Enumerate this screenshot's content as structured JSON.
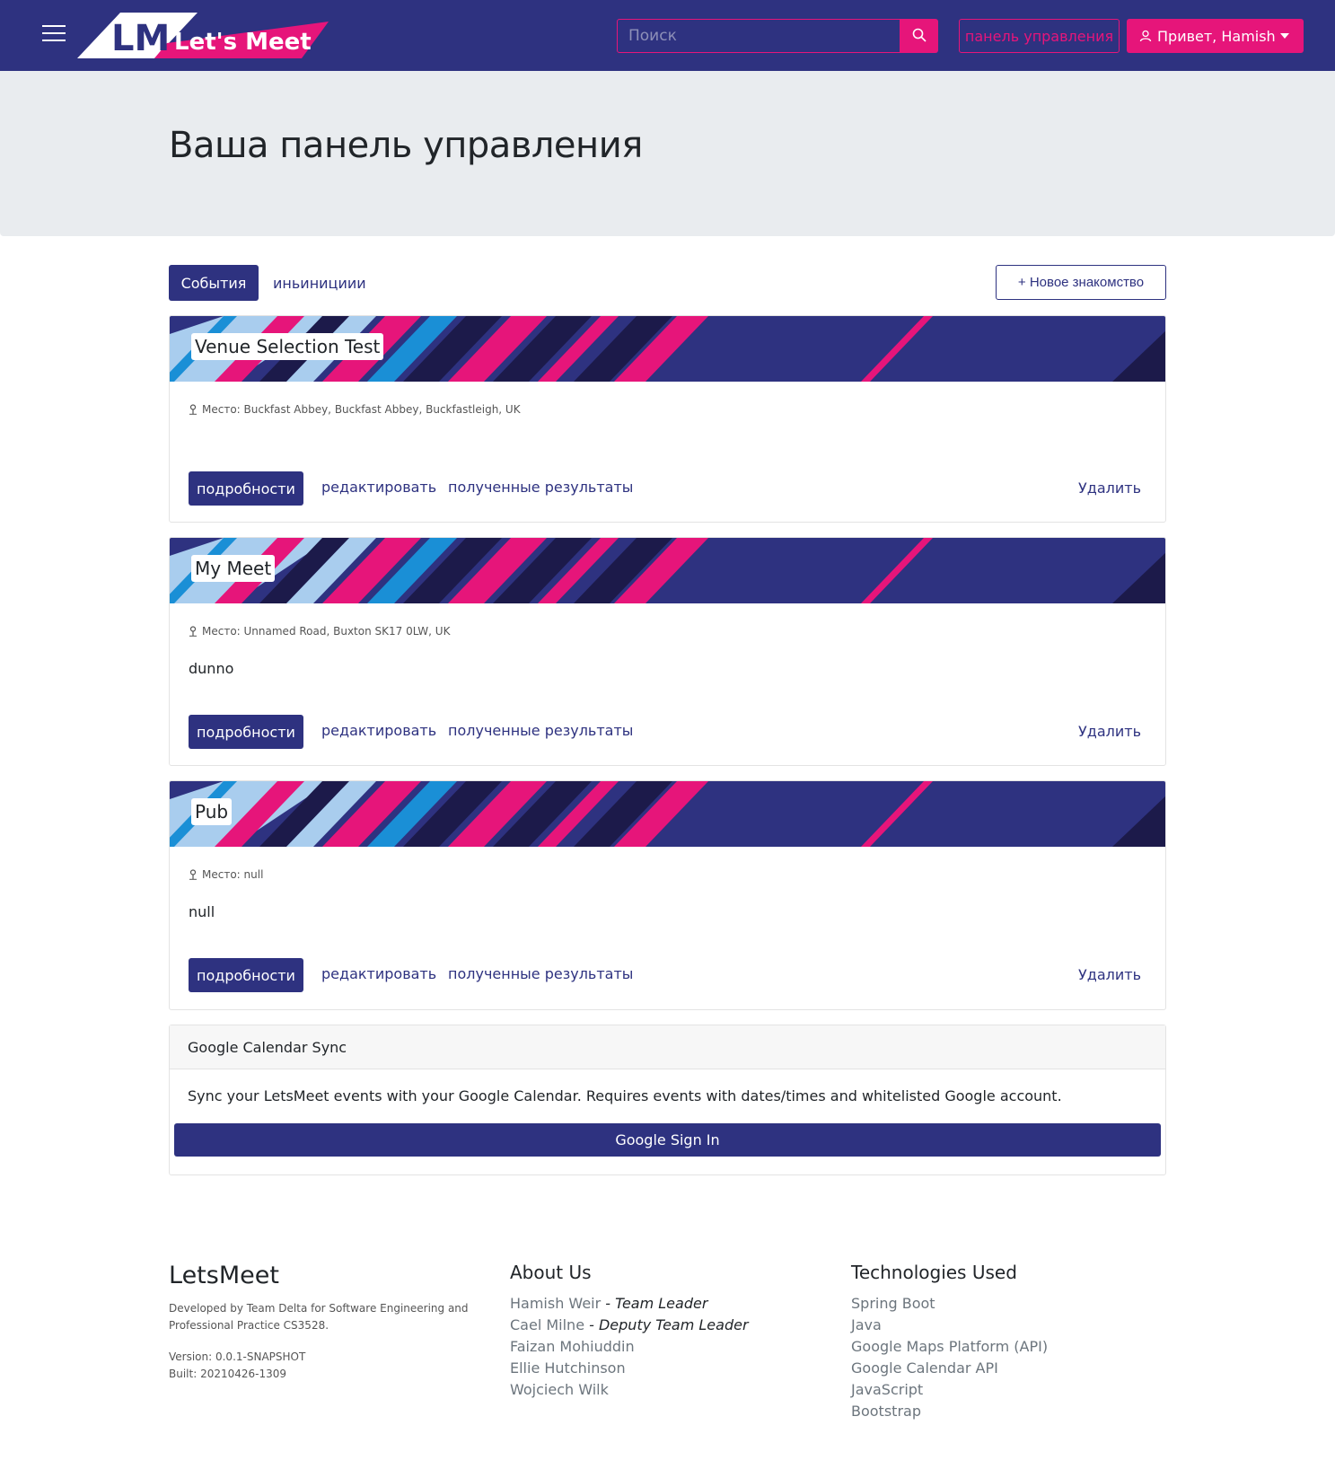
{
  "navbar": {
    "logo_text": "Let's Meet",
    "logo_mark": "LM",
    "search_placeholder": "Поиск",
    "dashboard_label": "панель управления",
    "user_label": "Привет, Hamish"
  },
  "page": {
    "title": "Ваша панель управления"
  },
  "tabs": {
    "events_label": "События",
    "initiatives_label": "иньинициии",
    "new_meet_label": "+ Новое знакомство"
  },
  "actions": {
    "details": "подробности",
    "edit": "редактировать",
    "results": "полученные результаты",
    "delete": "Удалить"
  },
  "events": [
    {
      "title": "Venue Selection Test",
      "location": "Место: Buckfast Abbey, Buckfast Abbey, Buckfastleigh, UK",
      "description": ""
    },
    {
      "title": "My Meet",
      "location": "Место: Unnamed Road, Buxton SK17 0LW, UK",
      "description": "dunno"
    },
    {
      "title": "Pub",
      "location": "Место: null",
      "description": "null"
    }
  ],
  "gcal": {
    "header": "Google Calendar Sync",
    "text": "Sync your LetsMeet events with your Google Calendar. Requires events with dates/times and whitelisted Google account.",
    "button": "Google Sign In"
  },
  "footer": {
    "brand": "LetsMeet",
    "developed": "Developed by Team Delta for Software Engineering and Professional Practice CS3528.",
    "version": "Version: 0.0.1-SNAPSHOT",
    "built": "Built: 20210426-1309",
    "about_heading": "About Us",
    "team": [
      {
        "name": "Hamish Weir",
        "role": "- Team Leader"
      },
      {
        "name": "Cael Milne",
        "role": "- Deputy Team Leader"
      },
      {
        "name": "Faizan Mohiuddin",
        "role": ""
      },
      {
        "name": "Ellie Hutchinson",
        "role": ""
      },
      {
        "name": "Wojciech Wilk",
        "role": ""
      }
    ],
    "tech_heading": "Technologies Used",
    "tech": [
      "Spring Boot",
      "Java",
      "Google Maps Platform (API)",
      "Google Calendar API",
      "JavaScript",
      "Bootstrap"
    ]
  },
  "colors": {
    "primary": "#2e3280",
    "accent": "#e6157a",
    "light_blue": "#a9cdee",
    "blue": "#1a8fd6",
    "dark": "#1c1a4a"
  },
  "icons": {
    "menu": "hamburger-icon",
    "search": "search-icon",
    "user": "user-icon",
    "location": "map-pin-icon"
  }
}
